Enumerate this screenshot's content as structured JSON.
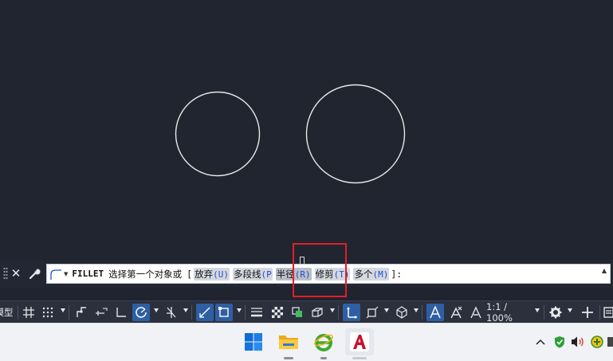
{
  "canvas": {
    "background": "#212530",
    "circle_color": "#e8e8e8"
  },
  "command_line": {
    "close_glyph": "✕",
    "command": "FILLET",
    "prompt": "选择第一个对象或",
    "open_bracket": "[",
    "options": [
      {
        "label": "放弃",
        "key": "(U)"
      },
      {
        "label": "多段线",
        "key": "(P"
      },
      {
        "label": "半径",
        "key": "(R)"
      },
      {
        "label": "修剪",
        "key": "(T)"
      },
      {
        "label": "多个",
        "key": "(M)"
      }
    ],
    "close": "]:",
    "scroll_glyph": "▲"
  },
  "status_bar": {
    "model_tab": "模型",
    "annotation_scale": "1:1 / 100%"
  },
  "taskbar": {
    "apps": [
      "windows-start",
      "file-explorer",
      "ie-browser",
      "autocad"
    ],
    "active_color": "#8a8f99"
  },
  "accent": {
    "highlight_box": "#e21f26",
    "status_on": "#2f5fa3"
  }
}
